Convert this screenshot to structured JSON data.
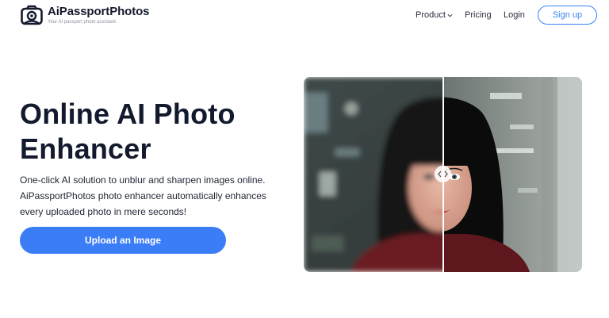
{
  "header": {
    "brand": "AiPassportPhotos",
    "tagline": "Your AI passport photo assistant.",
    "logo_icon": "camera-icon",
    "nav": {
      "product": "Product",
      "pricing": "Pricing",
      "login": "Login",
      "signup": "Sign up"
    }
  },
  "hero": {
    "title_line1": "Online AI Photo",
    "title_line2": "Enhancer",
    "desc_line1": "One-click AI solution to unblur and sharpen images online.",
    "desc_line2": "AiPassportPhotos photo enhancer automatically enhances",
    "desc_line3": "every uploaded photo in mere seconds!",
    "upload_label": "Upload an Image"
  },
  "colors": {
    "accent": "#3b7df6",
    "text": "#141a2e"
  },
  "comparison": {
    "handle_icon": "compare-arrows-icon"
  }
}
